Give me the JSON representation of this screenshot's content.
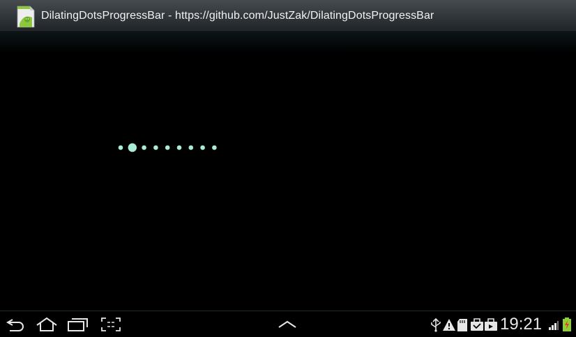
{
  "window": {
    "title": "DilatingDotsProgressBar - https://github.com/JustZak/DilatingDotsProgressBar",
    "app_icon": "android-app-icon"
  },
  "progress": {
    "type": "dilating-dots",
    "dot_count": 9,
    "active_dot_index": 1,
    "dot_color": "#a8ecd6"
  },
  "navigation": {
    "buttons": [
      "back-icon",
      "home-icon",
      "recent-apps-icon",
      "screenshot-icon",
      "menu-up-icon"
    ]
  },
  "status": {
    "icons": [
      "usb-icon",
      "warning-icon",
      "sd-card-icon",
      "email-icon",
      "store-icon",
      "signal-icon",
      "battery-charging-icon"
    ],
    "time": "19:21"
  },
  "colors": {
    "background": "#000000",
    "title_bar": "#3a3f44",
    "icon": "#e6e6e6",
    "battery": "#8ed033",
    "battery_warn": "#e43b2e"
  }
}
